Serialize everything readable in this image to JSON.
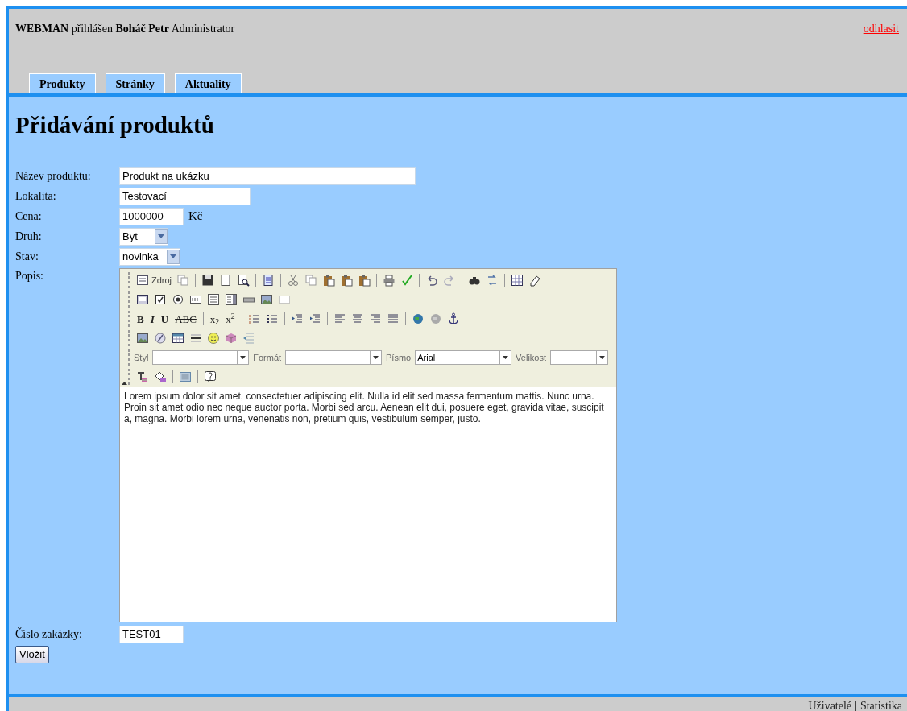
{
  "header": {
    "app": "WEBMAN",
    "logged_text": "přihlášen",
    "user": "Boháč Petr",
    "role": "Administrator",
    "logout": "odhlasit"
  },
  "tabs": [
    {
      "label": "Produkty"
    },
    {
      "label": "Stránky"
    },
    {
      "label": "Aktuality"
    }
  ],
  "heading": "Přidávání produktů",
  "form": {
    "fields": [
      {
        "kind": "text",
        "label": "Název produktu:",
        "value": "Produkt na ukázku"
      },
      {
        "kind": "text",
        "label": "Lokalita:",
        "value": "Testovací"
      },
      {
        "kind": "text",
        "label": "Cena:",
        "value": "1000000",
        "suffix": "Kč"
      },
      {
        "kind": "select",
        "label": "Druh:",
        "value": "Byt"
      },
      {
        "kind": "select",
        "label": "Stav:",
        "value": "novinka"
      }
    ],
    "editor": {
      "label": "Popis:",
      "source_label": "Zdroj",
      "format_buttons": [
        {
          "kind": "bold",
          "label": "B"
        },
        {
          "kind": "italic",
          "label": "I"
        },
        {
          "kind": "underline",
          "label": "U"
        },
        {
          "kind": "strike",
          "label": "ABC"
        },
        {
          "kind": "subscript",
          "label": "x$_{2}$"
        },
        {
          "kind": "superscript",
          "label": "x$^{2}$"
        }
      ],
      "combos": [
        {
          "label": "Styl"
        },
        {
          "label": "Formát"
        },
        {
          "label": "Písmo",
          "value": "Arial"
        },
        {
          "label": "Velikost"
        }
      ],
      "content": "Lorem ipsum dolor sit amet, consectetuer adipiscing elit. Nulla id elit sed massa fermentum mattis. Nunc urna. Proin sit amet odio nec neque auctor porta. Morbi sed arcu. Aenean elit dui, posuere eget, gravida vitae, suscipit a, magna. Morbi lorem urna, venenatis non, pretium quis, vestibulum semper, justo."
    },
    "order_label": "Číslo zakázky:",
    "order_value": "TEST01",
    "submit": "Vložit"
  },
  "footer": {
    "links": [
      "Uživatelé",
      "Statistika"
    ],
    "separator": "|"
  }
}
